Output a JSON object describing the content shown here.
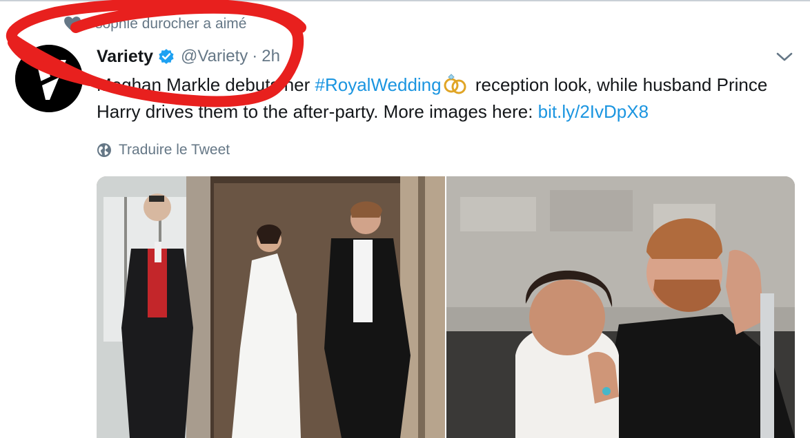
{
  "liked": {
    "text": "sophie durocher a aimé",
    "icon": "heart-icon"
  },
  "tweet": {
    "display_name": "Variety",
    "handle": "@Variety",
    "separator": "·",
    "time": "2h",
    "text_part1": "Meghan Markle debuts her ",
    "hashtag": "#RoyalWedding",
    "text_part2": " reception look, while husband Prince Harry drives them to the after-party. More images here: ",
    "url": "bit.ly/2IvDpX8",
    "translate_label": "Traduire le Tweet"
  },
  "colors": {
    "link": "#1b95e0",
    "secondary_text": "#657786",
    "primary_text": "#14171a",
    "annotation_red": "#e8201e",
    "verified_badge": "#1da1f2"
  },
  "media": {
    "photo_left": "couple-leaving-building-photo",
    "photo_right": "couple-waving-in-car-photo"
  }
}
